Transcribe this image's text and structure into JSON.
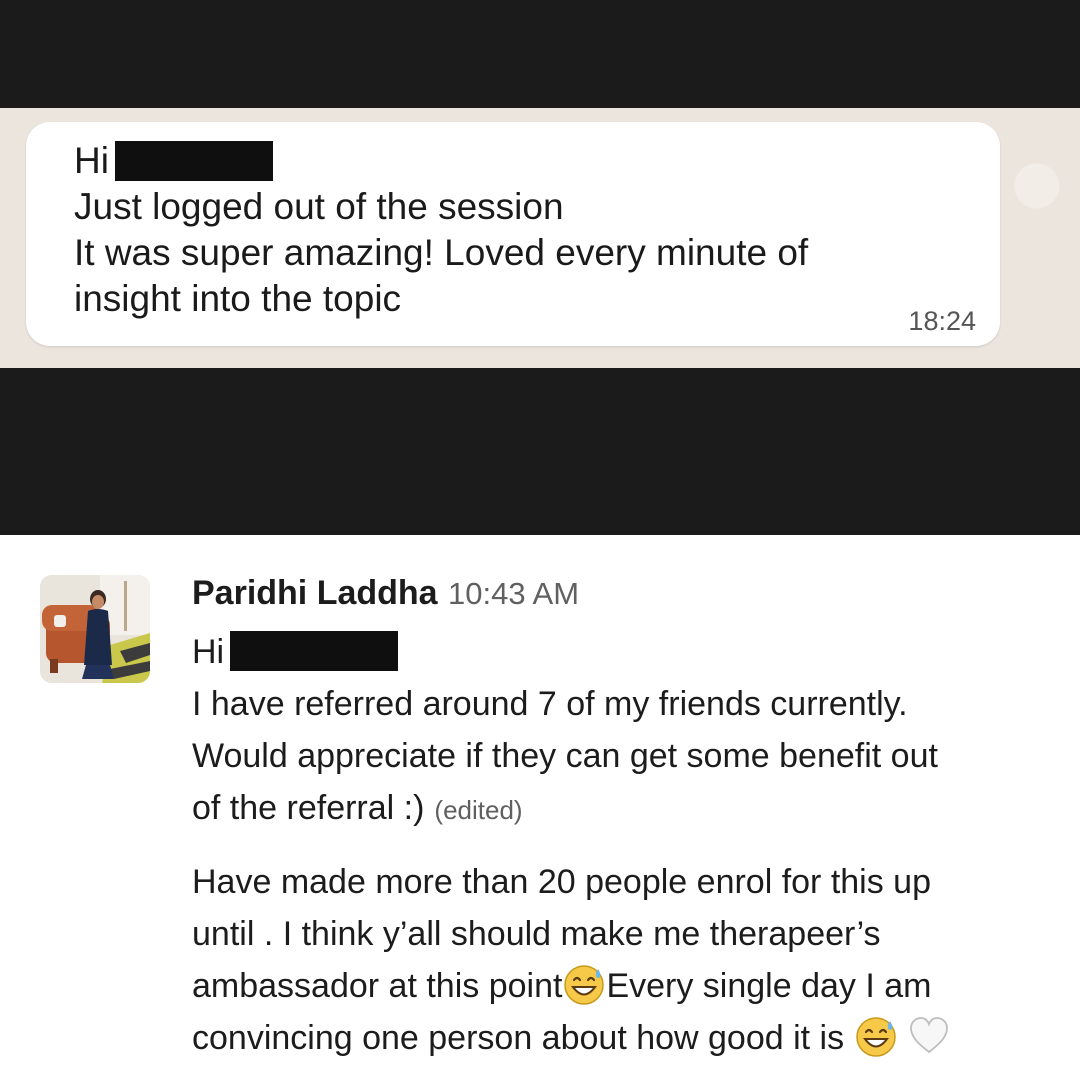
{
  "whatsapp_message": {
    "greeting": "Hi",
    "lines": [
      "Just logged out of the session",
      "It was super amazing! Loved every minute of",
      "insight into the topic"
    ],
    "time": "18:24"
  },
  "slack_message": {
    "sender": "Paridhi Laddha",
    "timestamp": "10:43 AM",
    "greeting": "Hi",
    "message_1_lines": [
      "I have referred around 7 of my friends currently.",
      "Would appreciate if they can get some benefit out",
      "of the referral :)"
    ],
    "edited_label": "(edited)",
    "message_2_lines": [
      "Have made more than 20 people enrol for this up",
      "until . I think y’all should make me therapeer’s",
      "ambassador at this point",
      "Every single day I am",
      "convincing one person about how good it is"
    ]
  },
  "icons": [
    "grinning-sweat-emoji",
    "white-heart-emoji"
  ],
  "colors": {
    "dark_band": "#1b1b1b",
    "chat_background": "#ece5dd",
    "bubble": "#ffffff",
    "redaction": "#0f0f0f",
    "slack_text": "#1d1c1d",
    "muted_text": "#616061"
  }
}
